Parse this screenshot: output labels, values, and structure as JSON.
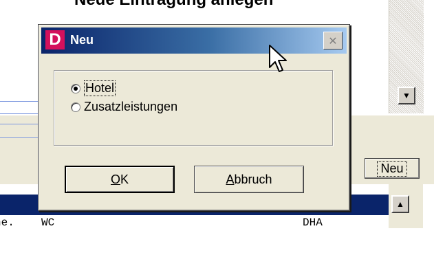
{
  "background": {
    "heading": "Neue Eintragung anlegen",
    "neu_button": "Neu",
    "row": {
      "col1": "ne.",
      "col2": "WC",
      "col3": "DHA"
    }
  },
  "dialog": {
    "icon_letter": "D",
    "title": "Neu",
    "close_symbol": "✕",
    "options": [
      {
        "label": "Hotel",
        "checked": true
      },
      {
        "label": "Zusatzleistungen",
        "checked": false
      }
    ],
    "ok": {
      "mnemonic": "O",
      "rest": "K"
    },
    "cancel": {
      "mnemonic": "A",
      "rest": "bbruch"
    }
  }
}
